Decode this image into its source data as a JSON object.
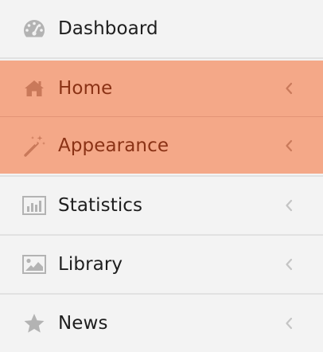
{
  "menu": {
    "items": [
      {
        "label": "Dashboard",
        "icon": "dashboard-gauge-icon",
        "has_chevron": false,
        "active": false
      },
      {
        "label": "Home",
        "icon": "home-icon",
        "has_chevron": true,
        "active": true
      },
      {
        "label": "Appearance",
        "icon": "magic-wand-icon",
        "has_chevron": true,
        "active": true
      },
      {
        "label": "Statistics",
        "icon": "bar-chart-icon",
        "has_chevron": true,
        "active": false
      },
      {
        "label": "Library",
        "icon": "picture-icon",
        "has_chevron": true,
        "active": false
      },
      {
        "label": "News",
        "icon": "star-icon",
        "has_chevron": true,
        "active": false
      }
    ]
  },
  "colors": {
    "background": "#f3f3f3",
    "active_background": "#f4a888",
    "active_text": "#8a3215",
    "text": "#1e1e1e",
    "icon_gray": "#b3b3b3",
    "active_icon": "#c9795a",
    "divider": "#e1e1e1"
  }
}
